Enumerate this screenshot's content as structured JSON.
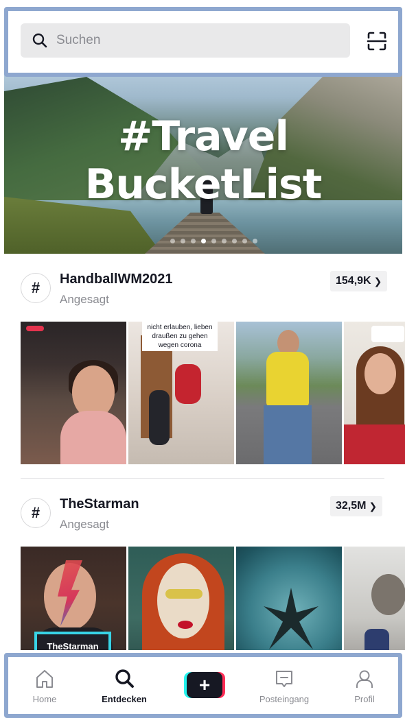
{
  "search": {
    "placeholder": "Suchen"
  },
  "hero": {
    "title": "#Travel\nBucketList",
    "slides": 9,
    "active_slide": 4
  },
  "sections": [
    {
      "tag": "HandballWM2021",
      "subtitle": "Angesagt",
      "count": "154,9K",
      "thumb_captions": [
        "nicht erlauben, lieben draußen zu gehen wegen corona"
      ]
    },
    {
      "tag": "TheStarman",
      "subtitle": "Angesagt",
      "count": "32,5M",
      "thumb_labels": [
        "TheStarman"
      ]
    }
  ],
  "nav": {
    "home": "Home",
    "discover": "Entdecken",
    "create": "+",
    "inbox": "Posteingang",
    "profile": "Profil"
  },
  "colors": {
    "accent_cyan": "#25f4ee",
    "accent_red": "#fe2c55",
    "text_primary": "#161823",
    "text_secondary": "#8a8b91"
  }
}
